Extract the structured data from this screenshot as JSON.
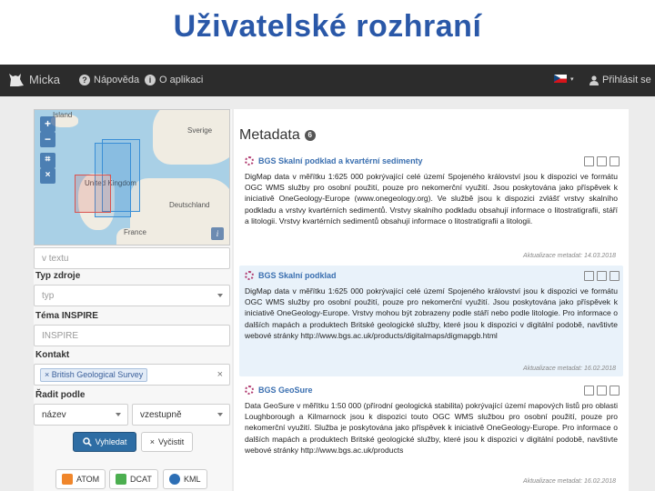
{
  "slide_title": "Uživatelské rozhraní",
  "navbar": {
    "brand": "Micka",
    "help": "Nápověda",
    "about": "O aplikaci",
    "login": "Přihlásit se"
  },
  "map": {
    "labels": {
      "island": "Island",
      "sverige": "Sverige",
      "united_kingdom": "United Kingdom",
      "deutschland": "Deutschland",
      "france": "France"
    }
  },
  "filters": {
    "text_placeholder": "v textu",
    "source_type_label": "Typ zdroje",
    "source_type_placeholder": "typ",
    "inspire_label": "Téma INSPIRE",
    "inspire_placeholder": "INSPIRE",
    "contact_label": "Kontakt",
    "contact_tag": "British Geological Survey",
    "sort_label": "Řadit podle",
    "sort_field": "název",
    "sort_order": "vzestupně",
    "search_button": "Vyhledat",
    "clear_button": "Vyčistit"
  },
  "feeds": {
    "atom": "ATOM",
    "dcat": "DCAT",
    "kml": "KML"
  },
  "metadata": {
    "title": "Metadata",
    "count": "6",
    "records": [
      {
        "title": "BGS Skalní podklad a kvartérní sedimenty",
        "body": "DigMap data v měřítku 1:625 000 pokrývající celé území Spojeného království jsou k dispozici ve formátu OGC WMS služby pro osobní použití, pouze pro nekomerční využití. Jsou poskytována jako příspěvek k iniciativě OneGeology-Europe (www.onegeology.org). Ve službě jsou k dispozici zvlášť vrstvy skalního podkladu a vrstvy kvartérních sedimentů. Vrstvy skalního podkladu obsahují informace o litostratigrafii, stáří a litologii. Vrstvy kvartérních sedimentů obsahují informace o litostratigrafii a litologii.",
        "date": "Aktualizace metadat: 14.03.2018"
      },
      {
        "title": "BGS Skalní podklad",
        "body": "DigMap data v měřítku 1:625 000 pokrývající celé území Spojeného království jsou k dispozici ve formátu OGC WMS služby pro osobní použití, pouze pro nekomerční využití. Jsou poskytována jako příspěvek k iniciativě OneGeology-Europe. Vrstvy mohou být zobrazeny podle stáří nebo podle litologie. Pro informace o dalších mapách a produktech Britské geologické služby, které jsou k dispozici v digitální podobě, navštivte webové stránky http://www.bgs.ac.uk/products/digitalmaps/digmapgb.html",
        "date": "Aktualizace metadat: 16.02.2018"
      },
      {
        "title": "BGS GeoSure",
        "body": "Data GeoSure v měřítku 1:50 000 (přírodní geologická stabilita) pokrývající území mapových listů pro oblasti Loughborough a Kilmarnock jsou k dispozici touto OGC WMS službou pro osobní použití, pouze pro nekomerční využití. Služba je poskytována jako příspěvek k iniciativě OneGeology-Europe. Pro informace o dalších mapách a produktech Britské geologické služby, které jsou k dispozici v digitální podobě, navštivte webové stránky http://www.bgs.ac.uk/products",
        "date": "Aktualizace metadat: 16.02.2018"
      }
    ]
  },
  "colors": {
    "title_blue": "#2a58a8",
    "navbar": "#2c2c2c",
    "link_blue": "#3a6fb0",
    "bbox_red": "#d9534f",
    "bbox_blue": "#3a8fd6"
  }
}
